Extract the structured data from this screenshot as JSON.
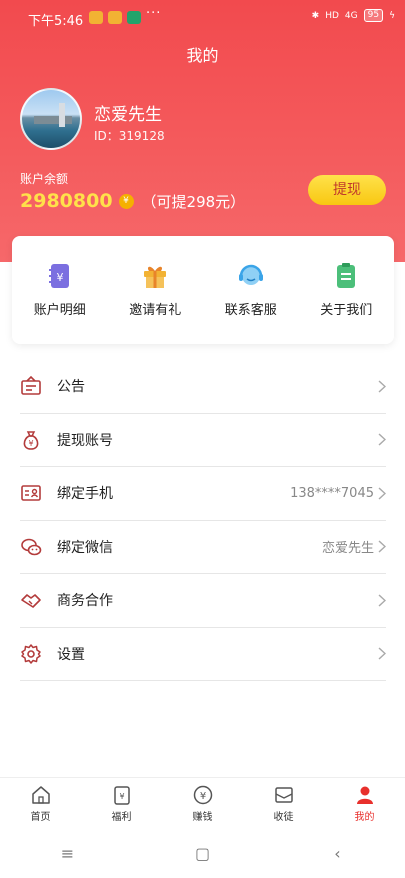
{
  "status_bar": {
    "time": "下午5:46",
    "dots": "···",
    "network": "HD",
    "signal": "4G",
    "battery": "95"
  },
  "page_title": "我的",
  "profile": {
    "name": "恋爱先生",
    "id_text": "ID：319128"
  },
  "balance": {
    "label": "账户余额",
    "value": "2980800",
    "coin_glyph": "¥",
    "withdrawable": "（可提298元）",
    "withdraw_button": "提现"
  },
  "quick_actions": [
    {
      "label": "账户明细",
      "icon": "account-detail-icon",
      "color": "#7b6fe0"
    },
    {
      "label": "邀请有礼",
      "icon": "gift-icon",
      "color": "#f2b233"
    },
    {
      "label": "联系客服",
      "icon": "customer-service-icon",
      "color": "#3aa4e8"
    },
    {
      "label": "关于我们",
      "icon": "clipboard-icon",
      "color": "#4cbf7a"
    }
  ],
  "menu": [
    {
      "label": "公告",
      "value": "",
      "icon": "announcement-icon"
    },
    {
      "label": "提现账号",
      "value": "",
      "icon": "money-bag-icon"
    },
    {
      "label": "绑定手机",
      "value": "138****7045",
      "icon": "id-card-icon"
    },
    {
      "label": "绑定微信",
      "value": "恋爱先生",
      "icon": "wechat-icon"
    },
    {
      "label": "商务合作",
      "value": "",
      "icon": "handshake-icon"
    },
    {
      "label": "设置",
      "value": "",
      "icon": "gear-icon"
    }
  ],
  "tabs": [
    {
      "label": "首页",
      "icon": "home-icon",
      "active": false
    },
    {
      "label": "福利",
      "icon": "welfare-icon",
      "active": false
    },
    {
      "label": "赚钱",
      "icon": "yen-icon",
      "active": false
    },
    {
      "label": "收徒",
      "icon": "mail-icon",
      "active": false
    },
    {
      "label": "我的",
      "icon": "user-icon",
      "active": true
    }
  ],
  "colors": {
    "brand_red": "#f24a4e",
    "balance_yellow": "#ffe14a",
    "button_yellow": "#f8c711",
    "menu_icon": "#b33b3b",
    "active_tab": "#e8302c"
  },
  "system_nav": {
    "menu": "≡",
    "home": "▢",
    "back": "‹"
  }
}
